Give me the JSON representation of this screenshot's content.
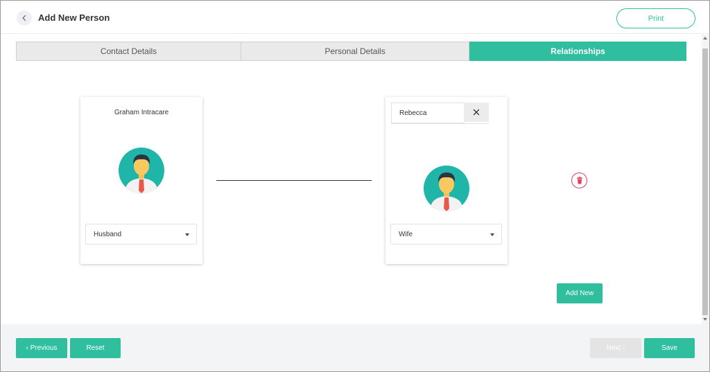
{
  "header": {
    "title": "Add New Person",
    "print_label": "Print"
  },
  "tabs": [
    {
      "label": "Contact Details",
      "active": false
    },
    {
      "label": "Personal Details",
      "active": false
    },
    {
      "label": "Relationships",
      "active": true
    }
  ],
  "relationship": {
    "left_person": {
      "name": "Graham Intracare",
      "role": "Husband"
    },
    "right_person": {
      "name_value": "Rebecca",
      "role": "Wife"
    }
  },
  "actions": {
    "add_new_label": "Add New"
  },
  "footer": {
    "previous_label": "‹ Previous",
    "reset_label": "Reset",
    "next_label": "Next ›",
    "save_label": "Save"
  },
  "colors": {
    "accent": "#2fbf9f",
    "danger": "#e0405a",
    "avatar_bg": "#1fb5a8"
  },
  "icons": {
    "back": "chevron-left-icon",
    "clear": "close-icon",
    "delete": "trash-icon",
    "avatar": "user-avatar-icon"
  }
}
